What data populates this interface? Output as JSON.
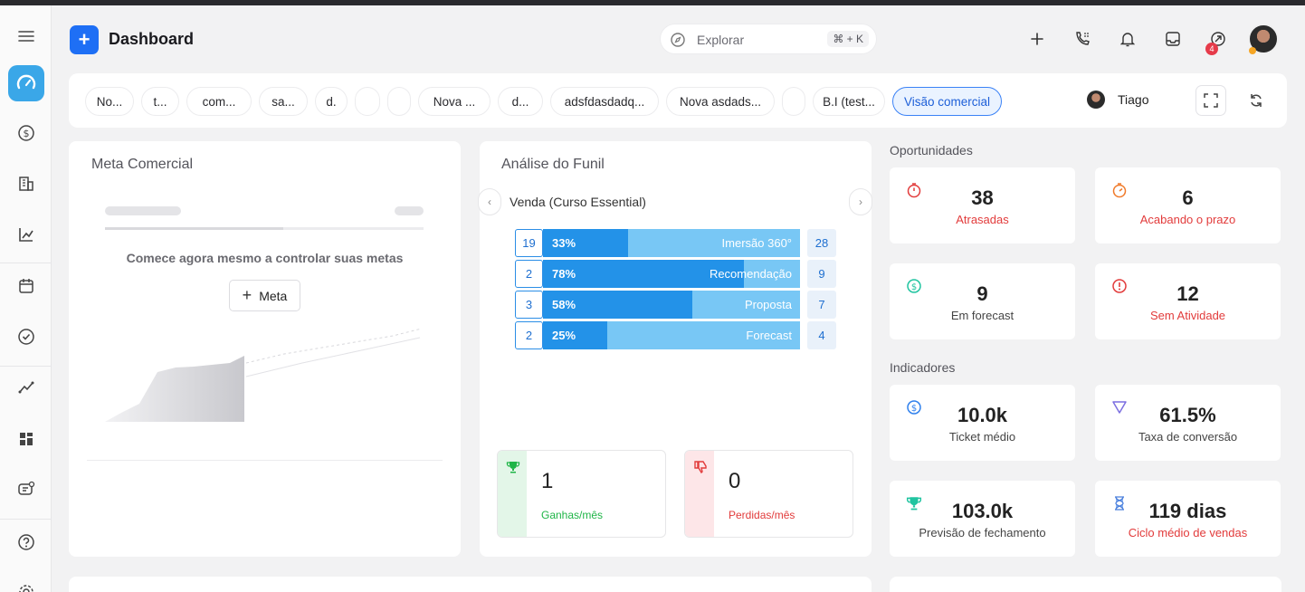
{
  "header": {
    "title": "Dashboard",
    "search_placeholder": "Explorar",
    "search_shortcut": "⌘ + K",
    "notification_count": "4"
  },
  "tabs": [
    {
      "label": "No..."
    },
    {
      "label": "t..."
    },
    {
      "label": "com..."
    },
    {
      "label": "sa..."
    },
    {
      "label": "d."
    },
    {
      "label": ""
    },
    {
      "label": ""
    },
    {
      "label": "Nova ..."
    },
    {
      "label": "d..."
    },
    {
      "label": "adsfdasdadq..."
    },
    {
      "label": "Nova asdads..."
    },
    {
      "label": ""
    },
    {
      "label": "B.I (test..."
    },
    {
      "label": "Visão comercial",
      "active": true
    }
  ],
  "user": {
    "name": "Tiago"
  },
  "meta": {
    "title": "Meta Comercial",
    "empty_text": "Comece agora mesmo a controlar suas metas",
    "button_label": "Meta"
  },
  "funnel": {
    "title": "Análise do Funil",
    "pipeline": "Venda (Curso Essential)",
    "stages": [
      {
        "left": "19",
        "pct": 33,
        "pct_label": "33%",
        "name": "Imersão 360°",
        "right": "28"
      },
      {
        "left": "2",
        "pct": 78,
        "pct_label": "78%",
        "name": "Recomendação",
        "right": "9"
      },
      {
        "left": "3",
        "pct": 58,
        "pct_label": "58%",
        "name": "Proposta",
        "right": "7"
      },
      {
        "left": "2",
        "pct": 25,
        "pct_label": "25%",
        "name": "Forecast",
        "right": "4"
      }
    ],
    "won": {
      "value": "1",
      "label": "Ganhas/mês"
    },
    "lost": {
      "value": "0",
      "label": "Perdidas/mês"
    }
  },
  "oportunidades": {
    "title": "Oportunidades",
    "items": [
      {
        "value": "38",
        "label": "Atrasadas"
      },
      {
        "value": "6",
        "label": "Acabando o prazo"
      },
      {
        "value": "9",
        "label": "Em forecast"
      },
      {
        "value": "12",
        "label": "Sem Atividade"
      }
    ]
  },
  "indicadores": {
    "title": "Indicadores",
    "items": [
      {
        "value": "10.0k",
        "label": "Ticket médio"
      },
      {
        "value": "61.5%",
        "label": "Taxa de conversão"
      },
      {
        "value": "103.0k",
        "label": "Previsão de fechamento"
      },
      {
        "value": "119 dias",
        "label": "Ciclo médio de vendas"
      }
    ]
  },
  "colors": {
    "primary": "#1e6ff5",
    "funnel_fill": "#2392e8",
    "funnel_track": "#78c7f5",
    "red": "#e23b3b",
    "green": "#1fb547",
    "teal": "#20c4a0",
    "orange": "#f07a2a",
    "purple": "#7c6fe0"
  }
}
